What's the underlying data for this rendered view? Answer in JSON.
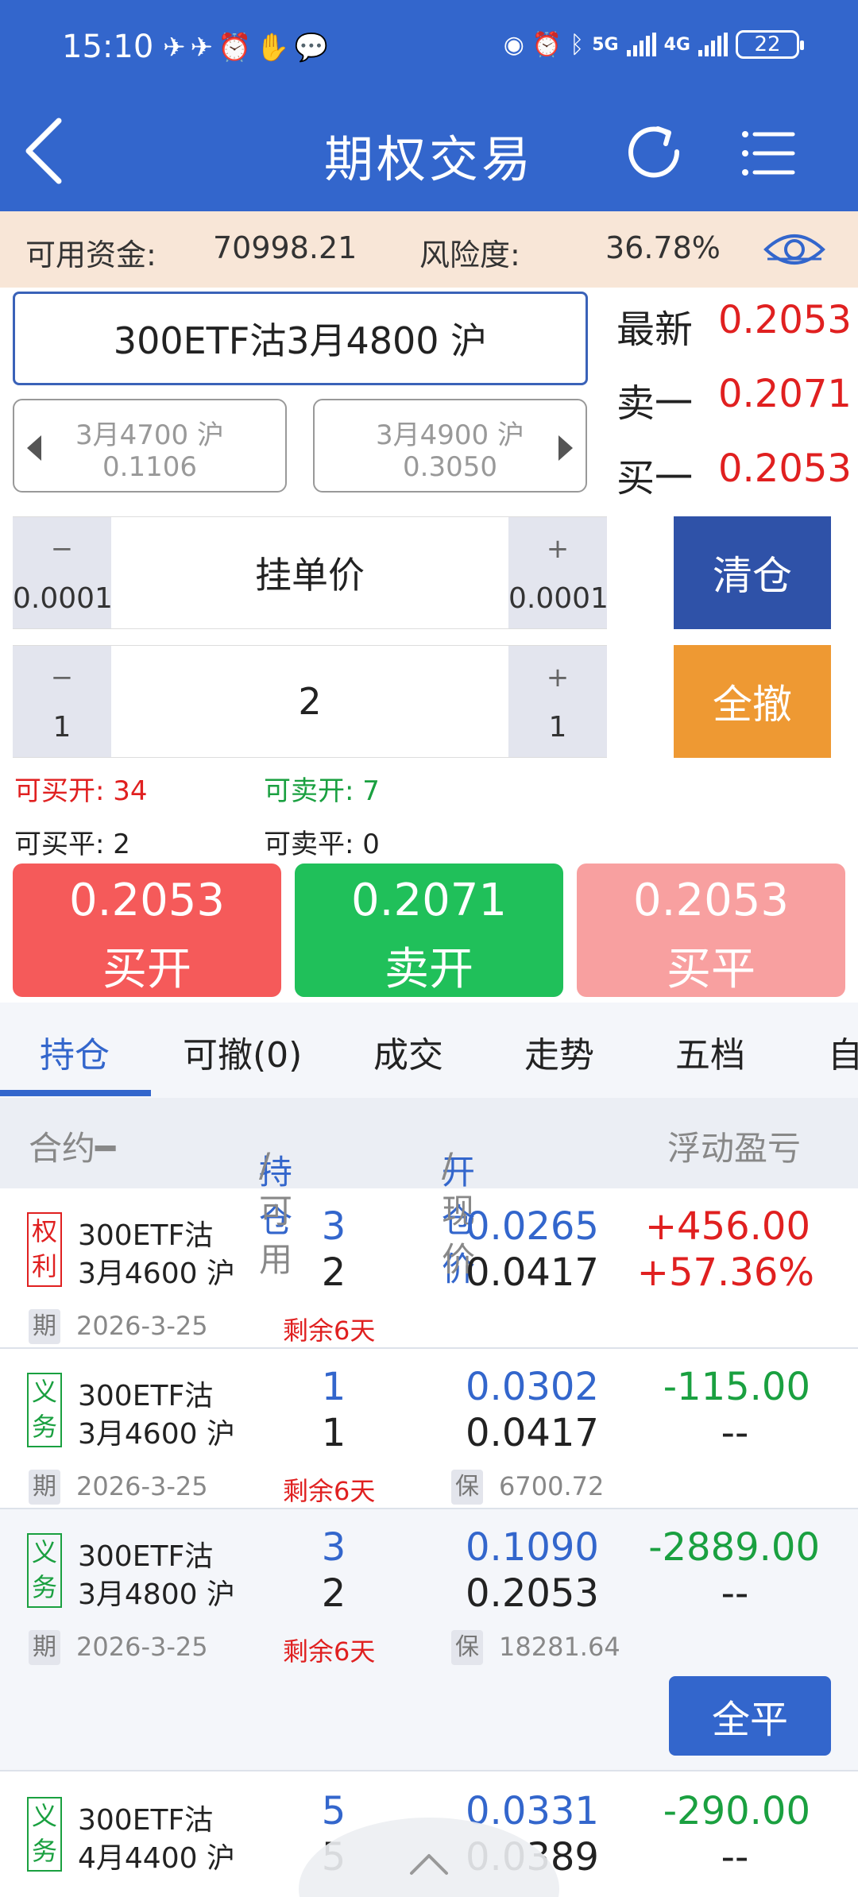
{
  "status": {
    "time": "15:10",
    "left_icons": "✈✈⏰✋💬",
    "signal_5g": "5G",
    "signal_4g": "4G",
    "battery": "22"
  },
  "nav": {
    "title": "期权交易"
  },
  "funds": {
    "available_label": "可用资金:",
    "available_value": "70998.21",
    "risk_label": "风险度:",
    "risk_value": "36.78%"
  },
  "contract": {
    "name": "300ETF沽3月4800 沪"
  },
  "quote": {
    "latest_label": "最新",
    "latest_value": "0.2053",
    "sell1_label": "卖一",
    "sell1_value": "0.2071",
    "buy1_label": "买一",
    "buy1_value": "0.2053"
  },
  "neighbors": {
    "prev_name": "3月4700 沪",
    "prev_price": "0.1106",
    "next_name": "3月4900 沪",
    "next_price": "0.3050"
  },
  "price_stepper": {
    "minus": "−",
    "minus_amt": "0.0001",
    "value": "挂单价",
    "plus": "+",
    "plus_amt": "0.0001"
  },
  "qty_stepper": {
    "minus": "−",
    "minus_amt": "1",
    "value": "2",
    "plus": "+",
    "plus_amt": "1"
  },
  "side_buttons": {
    "clear": "清仓",
    "cancel_all": "全撤"
  },
  "availability": {
    "can_buy_open": "可买开: 34",
    "can_sell_open": "可卖开: 7",
    "can_buy_close": "可买平: 2",
    "can_sell_close": "可卖平: 0"
  },
  "trade_buttons": {
    "buy_open_price": "0.2053",
    "buy_open_label": "买开",
    "sell_open_price": "0.2071",
    "sell_open_label": "卖开",
    "buy_close_price": "0.2053",
    "buy_close_label": "买平"
  },
  "tabs": [
    "持仓",
    "可撤(0)",
    "成交",
    "走势",
    "五档",
    "自"
  ],
  "columns": {
    "contract": "合约━",
    "pos_a": "持仓",
    "pos_b": "/可用",
    "price_a": "开仓价",
    "price_b": "/现价",
    "pnl": "浮动盈亏"
  },
  "positions": [
    {
      "type": "权利",
      "l1": "300ETF沽",
      "l2": "3月4600 沪",
      "hold": "3",
      "avail": "2",
      "open": "0.0265",
      "now": "0.0417",
      "pnl": "+456.00",
      "pnl_pct": "+57.36%",
      "exp_tag": "期",
      "expiry": "2026-3-25",
      "remain": "剩余6天",
      "margin_tag": "",
      "margin": ""
    },
    {
      "type": "义务",
      "l1": "300ETF沽",
      "l2": "3月4600 沪",
      "hold": "1",
      "avail": "1",
      "open": "0.0302",
      "now": "0.0417",
      "pnl": "-115.00",
      "pnl_pct": "--",
      "exp_tag": "期",
      "expiry": "2026-3-25",
      "remain": "剩余6天",
      "margin_tag": "保",
      "margin": "6700.72"
    },
    {
      "type": "义务",
      "l1": "300ETF沽",
      "l2": "3月4800 沪",
      "hold": "3",
      "avail": "2",
      "open": "0.1090",
      "now": "0.2053",
      "pnl": "-2889.00",
      "pnl_pct": "--",
      "exp_tag": "期",
      "expiry": "2026-3-25",
      "remain": "剩余6天",
      "margin_tag": "保",
      "margin": "18281.64"
    },
    {
      "type": "义务",
      "l1": "300ETF沽",
      "l2": "4月4400 沪",
      "hold": "5",
      "avail": "5",
      "open": "0.0331",
      "now": "0.0389",
      "pnl": "-290.00",
      "pnl_pct": "--"
    }
  ],
  "close_all": "全平",
  "colors": {
    "brand": "#3366cc",
    "fund_bg": "#f8e6d7",
    "up": "#e02020",
    "down": "#1aa040",
    "orange": "#ee9933"
  }
}
